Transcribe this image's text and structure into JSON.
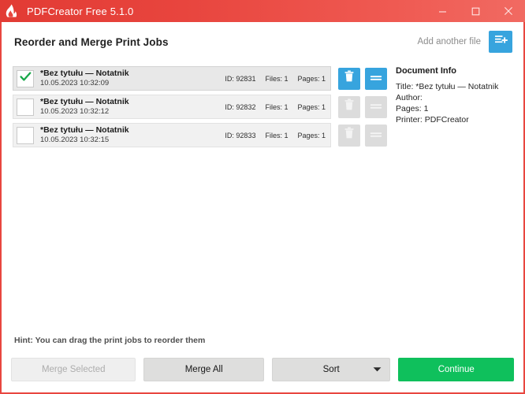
{
  "window": {
    "title": "PDFCreator Free 5.1.0",
    "icon": "pdfcreator-flame-icon",
    "accent_red": "#e8463f",
    "controls": {
      "minimize": "minimize-icon",
      "maximize": "maximize-icon",
      "close": "close-icon"
    }
  },
  "header": {
    "page_title": "Reorder and Merge Print Jobs",
    "add_another_file_label": "Add another file",
    "add_another_file_icon": "add-file-icon",
    "add_button_color": "#37a4de"
  },
  "jobs": [
    {
      "checked": true,
      "check_icon": "green-check-icon",
      "title": "*Bez tytułu — Notatnik",
      "date": "10.05.2023 10:32:09",
      "id_label": "ID: 92831",
      "files_label": "Files: 1",
      "pages_label": "Pages: 1",
      "delete_icon": "trash-icon",
      "merge_icon": "merge-lines-icon",
      "actions_enabled": true
    },
    {
      "checked": false,
      "check_icon": "green-check-icon",
      "title": "*Bez tytułu — Notatnik",
      "date": "10.05.2023 10:32:12",
      "id_label": "ID: 92832",
      "files_label": "Files: 1",
      "pages_label": "Pages: 1",
      "delete_icon": "trash-icon",
      "merge_icon": "merge-lines-icon",
      "actions_enabled": false
    },
    {
      "checked": false,
      "check_icon": "green-check-icon",
      "title": "*Bez tytułu — Notatnik",
      "date": "10.05.2023 10:32:15",
      "id_label": "ID: 92833",
      "files_label": "Files: 1",
      "pages_label": "Pages: 1",
      "delete_icon": "trash-icon",
      "merge_icon": "merge-lines-icon",
      "actions_enabled": false
    }
  ],
  "document_info": {
    "heading": "Document Info",
    "title_line": "Title: *Bez tytułu — Notatnik",
    "author_line": "Author:",
    "pages_line": "Pages: 1",
    "printer_line": "Printer: PDFCreator"
  },
  "footer": {
    "hint": "Hint: You can drag the print jobs to reorder them",
    "merge_selected_label": "Merge Selected",
    "merge_all_label": "Merge All",
    "sort_label": "Sort",
    "sort_caret_icon": "chevron-down-icon",
    "continue_label": "Continue",
    "continue_color": "#0fc05c"
  }
}
